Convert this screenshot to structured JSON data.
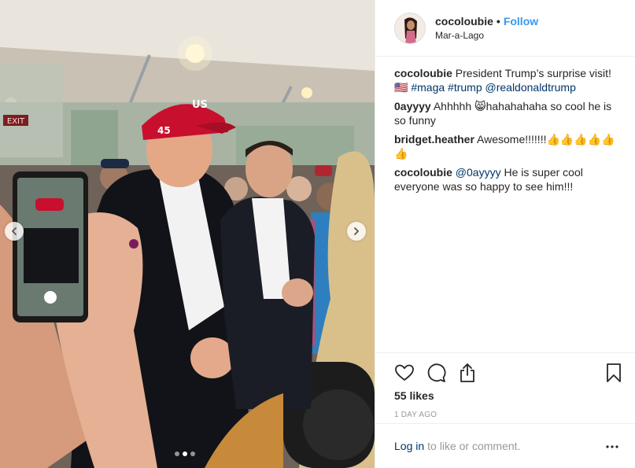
{
  "post": {
    "username": "cocoloubie",
    "bullet": "•",
    "follow_label": "Follow",
    "location": "Mar-a-Lago",
    "image_alt": "Man in red cap and dark blazer greeted by a crowd holding phones inside a tent",
    "media": {
      "cap_text": "45",
      "cap_text_front": "US",
      "exit_sign": "EXIT",
      "carousel_index": 2,
      "carousel_total": 3
    },
    "caption": {
      "user": "cocoloubie",
      "text": "President Trump’s surprise visit!",
      "flag": "🇺🇸",
      "hashtags": [
        "#maga",
        "#trump"
      ],
      "mention": "@realdonaldtrump"
    },
    "comments": [
      {
        "user": "0ayyyy",
        "text": "Ahhhhh 😸hahahahaha so cool he is so funny"
      },
      {
        "user": "bridget.heather",
        "text": "Awesome!!!!!!!👍👍👍👍👍👍"
      },
      {
        "user": "cocoloubie",
        "mention": "@0ayyyy",
        "text": "He is super cool everyone was so happy to see him!!!"
      }
    ],
    "actions": {
      "like_icon": "heart-icon",
      "comment_icon": "speech-bubble-icon",
      "share_icon": "share-icon",
      "save_icon": "bookmark-icon"
    },
    "likes_count": "55",
    "likes_word": "likes",
    "timestamp": "1 DAY AGO",
    "login": {
      "link": "Log in",
      "rest": "to like or comment.",
      "more_icon": "ellipsis-icon"
    }
  },
  "colors": {
    "link_blue": "#3897f0",
    "tag_blue": "#003569",
    "text": "#262626",
    "muted": "#999999",
    "border": "#efefef",
    "cap_red": "#c8102e"
  }
}
